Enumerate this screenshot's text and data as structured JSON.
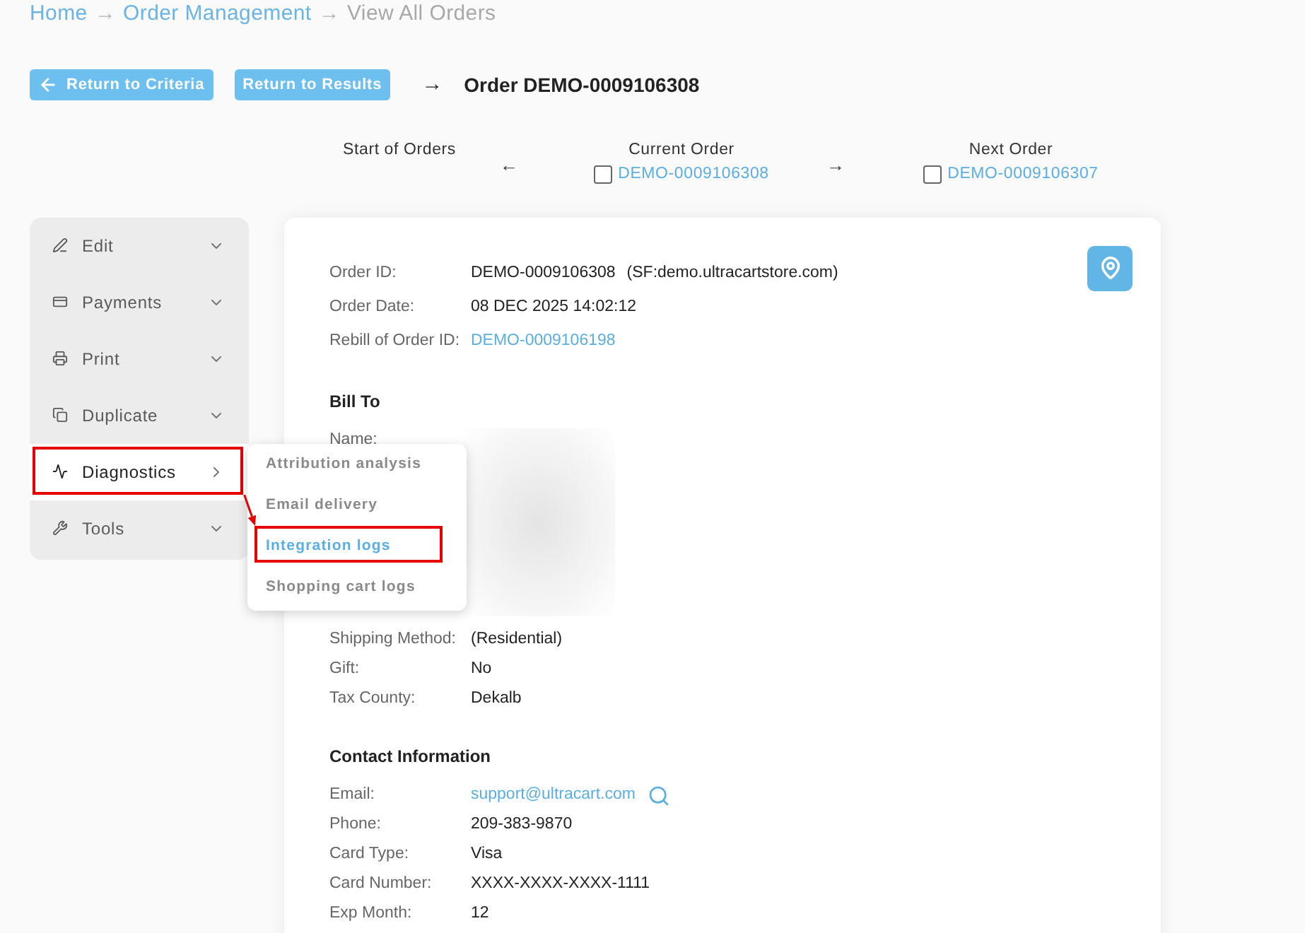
{
  "breadcrumb": [
    {
      "label": "Home",
      "current": false,
      "arrow": "→"
    },
    {
      "label": "Order Management",
      "current": false,
      "arrow": "→"
    },
    {
      "label": "View All Orders",
      "current": true
    }
  ],
  "actions": [
    {
      "label": "Return to Criteria",
      "kind": "back"
    },
    {
      "label": "Return to Results",
      "kind": "plain"
    }
  ],
  "title": {
    "arrow": "→",
    "text": "Order DEMO-0009106308"
  },
  "order_nav": [
    {
      "kind": "slot",
      "heading": "Start of Orders"
    },
    {
      "kind": "arrow",
      "text": "←"
    },
    {
      "kind": "slot",
      "heading": "Current Order",
      "checked": false,
      "order_id": "DEMO-0009106308"
    },
    {
      "kind": "arrow",
      "text": "→"
    },
    {
      "kind": "slot",
      "heading": "Next Order",
      "checked": false,
      "order_id": "DEMO-0009106307"
    }
  ],
  "sidebar": {
    "items": [
      {
        "label": "Edit",
        "kind": "edit",
        "selected": false,
        "highlighted": false
      },
      {
        "label": "Payments",
        "kind": "payments",
        "selected": false,
        "highlighted": false
      },
      {
        "label": "Print",
        "kind": "print",
        "selected": false,
        "highlighted": false
      },
      {
        "label": "Duplicate",
        "kind": "duplicate",
        "selected": false,
        "highlighted": false
      },
      {
        "label": "Diagnostics",
        "kind": "diagnostics",
        "selected": true,
        "highlighted": true
      },
      {
        "label": "Tools",
        "kind": "tools",
        "selected": false,
        "highlighted": false
      }
    ]
  },
  "submenu": {
    "items": [
      {
        "label": "Attribution analysis",
        "selected": false,
        "highlighted": false
      },
      {
        "label": "Email delivery",
        "selected": false,
        "highlighted": false
      },
      {
        "label": "Integration logs",
        "selected": true,
        "highlighted": true
      },
      {
        "label": "Shopping cart logs",
        "selected": false,
        "highlighted": false
      }
    ]
  },
  "card": {
    "sections": [
      {
        "rows": [
          {
            "label": "Order ID:",
            "value": "DEMO-0009106308",
            "note": "(SF:demo.ultracartstore.com)",
            "kind": "text"
          },
          {
            "label": "Order Date:",
            "value": "08 DEC 2025 14:02:12",
            "kind": "text"
          },
          {
            "label": "Rebill of Order ID:",
            "value": "DEMO-0009106198",
            "kind": "link"
          }
        ]
      },
      {
        "heading": "Bill To",
        "rows": [
          {
            "label": "Name:",
            "kind": "redacted"
          },
          {
            "label": "Shipping Method:",
            "value": "(Residential)",
            "kind": "text"
          },
          {
            "label": "Gift:",
            "value": "No",
            "kind": "text"
          },
          {
            "label": "Tax County:",
            "value": "Dekalb",
            "kind": "text"
          }
        ]
      },
      {
        "heading": "Contact Information",
        "rows": [
          {
            "label": "Email:",
            "value": "support@ultracart.com",
            "kind": "email"
          },
          {
            "label": "Phone:",
            "value": "209-383-9870",
            "kind": "text"
          },
          {
            "label": "Card Type:",
            "value": "Visa",
            "kind": "text"
          },
          {
            "label": "Card Number:",
            "value": "XXXX-XXXX-XXXX-1111",
            "kind": "text"
          },
          {
            "label": "Exp Month:",
            "value": "12",
            "kind": "text"
          }
        ]
      }
    ]
  }
}
